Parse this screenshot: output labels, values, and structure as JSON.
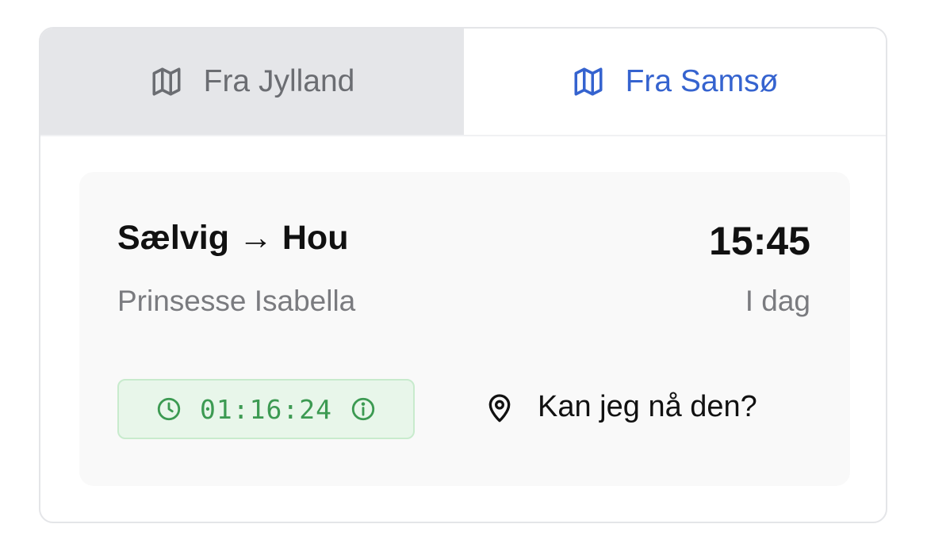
{
  "tabs": [
    {
      "label": "Fra Jylland",
      "icon": "map-icon",
      "active": false
    },
    {
      "label": "Fra Samsø",
      "icon": "map-icon",
      "active": true
    }
  ],
  "departure": {
    "route": "Sælvig → Hou",
    "ship": "Prinsesse Isabella",
    "time": "15:45",
    "day": "I dag"
  },
  "countdown": {
    "value": "01:16:24",
    "clock_icon": "clock-icon",
    "info_icon": "info-icon"
  },
  "reach": {
    "label": "Kan jeg nå den?",
    "icon": "map-pin-icon"
  },
  "colors": {
    "accent": "#3563cf",
    "inactive_tab_bg": "#e5e6e9",
    "countdown_text": "#3c9a52",
    "countdown_bg": "#e8f6ea"
  }
}
